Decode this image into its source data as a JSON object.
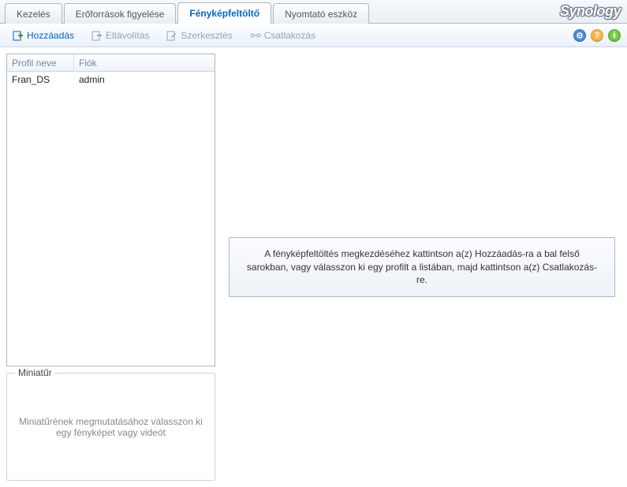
{
  "brand": "Synology",
  "tabs": [
    {
      "label": "Kezelés",
      "active": false
    },
    {
      "label": "Erőforrások figyelése",
      "active": false
    },
    {
      "label": "Fényképfeltöltő",
      "active": true
    },
    {
      "label": "Nyomtató eszköz",
      "active": false
    }
  ],
  "toolbar": {
    "add": "Hozzáadás",
    "remove": "Eltávolítás",
    "edit": "Szerkesztés",
    "connect": "Csatlakozás"
  },
  "grid": {
    "columns": {
      "profile": "Profil neve",
      "account": "Fiók"
    },
    "rows": [
      {
        "profile": "Fran_DS",
        "account": "admin"
      }
    ]
  },
  "thumbnail": {
    "title": "Miniatűr",
    "placeholder": "Miniatűrének megmutatásához válasszon ki egy fényképet vagy videót"
  },
  "message": "A fényképfeltöltés megkezdéséhez kattintson a(z) Hozzáadás-ra a bal felső sarokban, vagy válasszon ki egy profilt a listában, majd kattintson a(z) Csatlakozás-re.",
  "icons": {
    "help": "?",
    "info": "i"
  }
}
